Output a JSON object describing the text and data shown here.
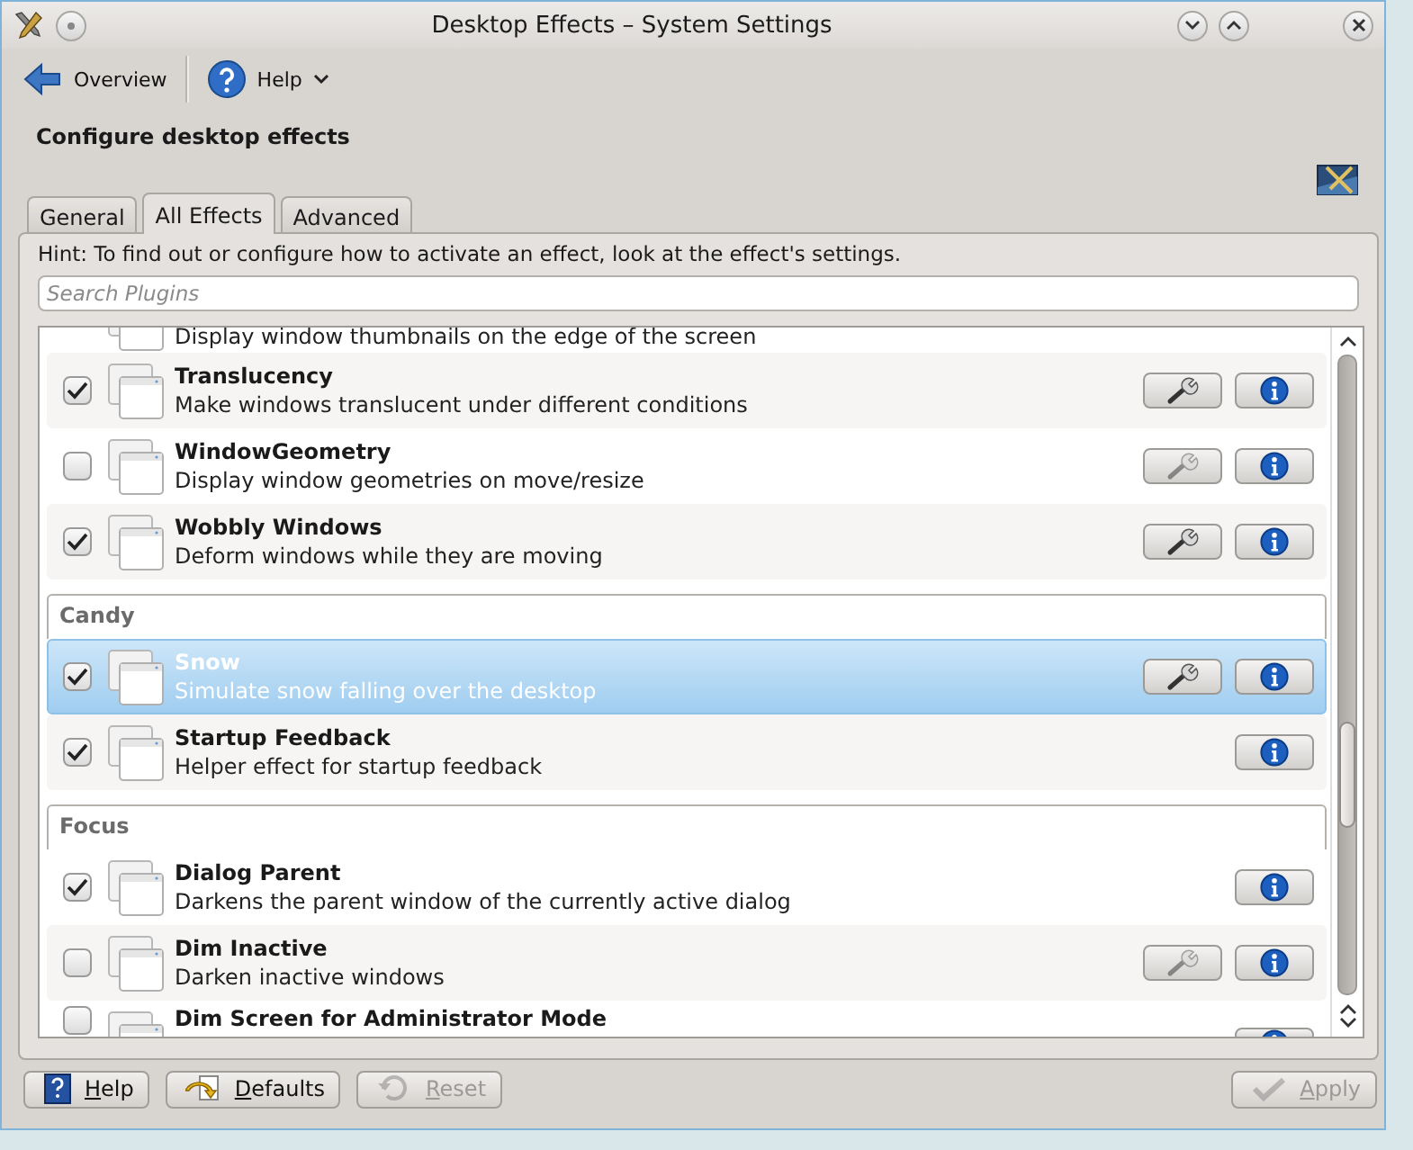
{
  "window": {
    "title": "Desktop Effects – System Settings"
  },
  "toolbar": [
    {
      "kind": "back",
      "label": "Overview"
    },
    {
      "kind": "help",
      "label": "Help"
    }
  ],
  "header": {
    "title": "Configure desktop effects"
  },
  "tabs": [
    {
      "label": "General",
      "selected": false
    },
    {
      "label": "All Effects",
      "selected": true
    },
    {
      "label": "Advanced",
      "selected": false
    }
  ],
  "hint": "Hint: To find out or configure how to activate an effect, look at the effect's settings.",
  "search": {
    "placeholder": "Search Plugins"
  },
  "list": [
    {
      "kind": "effect",
      "description": "Display window thumbnails on the edge of the screen",
      "selected": false
    },
    {
      "kind": "effect",
      "name": "Translucency",
      "description": "Make windows translucent under different conditions",
      "checked": true,
      "selected": false,
      "configurable": true,
      "config_disabled": false
    },
    {
      "kind": "effect",
      "name": "WindowGeometry",
      "description": "Display window geometries on move/resize",
      "checked": false,
      "selected": false,
      "configurable": true,
      "config_disabled": true
    },
    {
      "kind": "effect",
      "name": "Wobbly Windows",
      "description": "Deform windows while they are moving",
      "checked": true,
      "selected": false,
      "configurable": true,
      "config_disabled": false
    },
    {
      "kind": "category",
      "label": "Candy"
    },
    {
      "kind": "effect",
      "name": "Snow",
      "description": "Simulate snow falling over the desktop",
      "checked": true,
      "selected": true,
      "configurable": true,
      "config_disabled": false
    },
    {
      "kind": "effect",
      "name": "Startup Feedback",
      "description": "Helper effect for startup feedback",
      "checked": true,
      "selected": false,
      "configurable": false
    },
    {
      "kind": "category",
      "label": "Focus"
    },
    {
      "kind": "effect",
      "name": "Dialog Parent",
      "description": "Darkens the parent window of the currently active dialog",
      "checked": true,
      "selected": false,
      "configurable": false
    },
    {
      "kind": "effect",
      "name": "Dim Inactive",
      "description": "Darken inactive windows",
      "checked": false,
      "selected": false,
      "configurable": true,
      "config_disabled": true
    },
    {
      "kind": "effect",
      "name": "Dim Screen for Administrator Mode",
      "checked": false,
      "selected": false,
      "configurable": false
    }
  ],
  "buttons": [
    {
      "kind": "help",
      "label": "Help",
      "disabled": false
    },
    {
      "kind": "defaults",
      "label": "Defaults",
      "disabled": false
    },
    {
      "kind": "reset",
      "label": "Reset",
      "disabled": true
    },
    {
      "kind": "apply",
      "label": "Apply",
      "disabled": true
    }
  ]
}
